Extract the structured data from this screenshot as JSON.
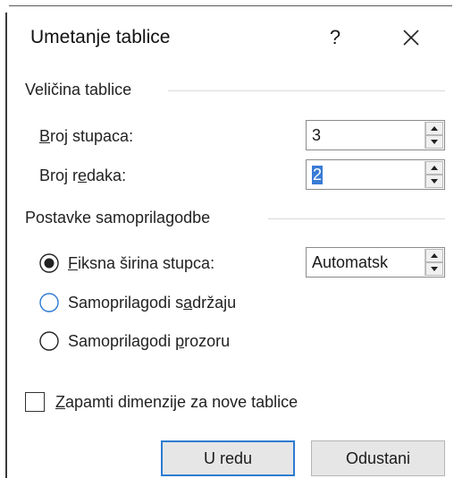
{
  "window": {
    "title": "Umetanje tablice",
    "help_label": "?",
    "close_icon": "close-icon"
  },
  "table_size": {
    "group_label": "Veličina tablice",
    "columns": {
      "label_prefix": "",
      "label_accel": "B",
      "label_rest": "roj stupaca:",
      "value": "3"
    },
    "rows": {
      "label_prefix": "Broj r",
      "label_accel": "e",
      "label_rest": "daka:",
      "value": "2"
    }
  },
  "autofit": {
    "group_label": "Postavke samoprilagodbe",
    "fixed_width": {
      "label_prefix": "",
      "label_accel": "F",
      "label_rest": "iksna širina stupca:",
      "selected": true,
      "value": "Automatsk"
    },
    "autofit_contents": {
      "label_prefix": "Samoprilagodi s",
      "label_accel": "a",
      "label_rest": "držaju",
      "selected": false
    },
    "autofit_window": {
      "label_prefix": "Samoprilagodi ",
      "label_accel": "p",
      "label_rest": "rozoru",
      "selected": false
    }
  },
  "remember": {
    "label_prefix": "",
    "label_accel": "Z",
    "label_rest": "apamti dimenzije za nove tablice",
    "checked": false
  },
  "buttons": {
    "ok": "U redu",
    "cancel": "Odustani"
  },
  "colors": {
    "accent": "#2d7bd1",
    "selection": "#3a7bd5",
    "radio_unchecked_border": "#2b7cd3"
  }
}
